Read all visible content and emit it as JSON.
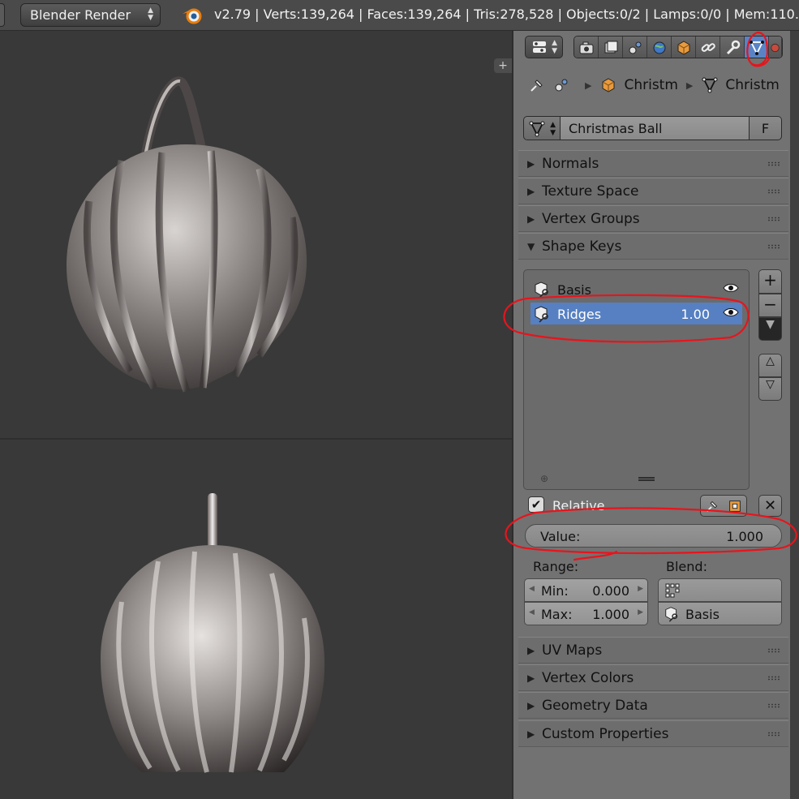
{
  "header": {
    "render_engine": "Blender Render",
    "stats": "v2.79 | Verts:139,264 | Faces:139,264 | Tris:278,528 | Objects:0/2 | Lamps:0/0 | Mem:110."
  },
  "viewport": {
    "tab_label": "+"
  },
  "properties": {
    "breadcrumb": {
      "object_name": "Christm",
      "mesh_name": "Christm"
    },
    "mesh_datablock": {
      "name": "Christmas Ball",
      "fake_user": "F"
    },
    "panels_top": [
      "Normals",
      "Texture Space",
      "Vertex Groups"
    ],
    "shape_keys": {
      "title": "Shape Keys",
      "items": [
        {
          "name": "Basis",
          "value": "",
          "selected": false
        },
        {
          "name": "Ridges",
          "value": "1.00",
          "selected": true
        }
      ],
      "relative_label": "Relative",
      "relative_checked": true,
      "value_label": "Value:",
      "value": "1.000",
      "range_label": "Range:",
      "blend_label": "Blend:",
      "min_label": "Min:",
      "min_value": "0.000",
      "max_label": "Max:",
      "max_value": "1.000",
      "relative_key": "Basis"
    },
    "panels_bottom": [
      "UV Maps",
      "Vertex Colors",
      "Geometry Data",
      "Custom Properties"
    ]
  },
  "colors": {
    "selection": "#5680c2",
    "annotation": "#e8141c",
    "panel_bg": "#727272"
  }
}
